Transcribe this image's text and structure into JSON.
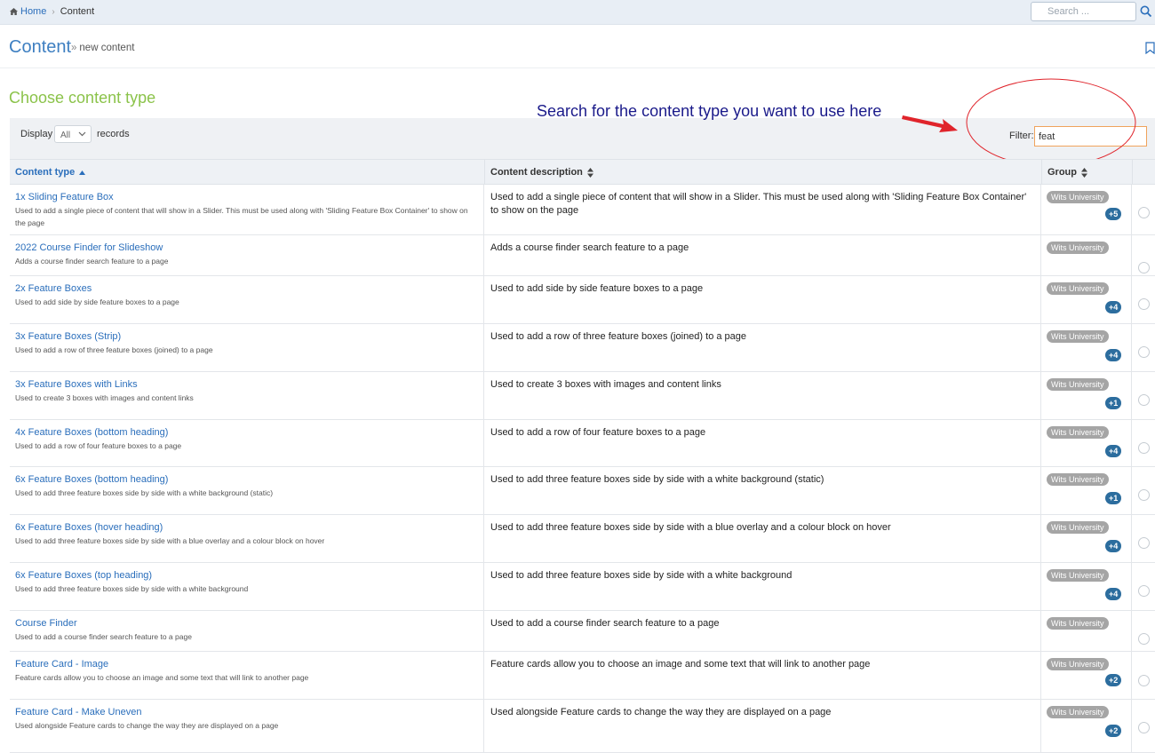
{
  "breadcrumb": {
    "home": "Home",
    "current": "Content"
  },
  "search": {
    "placeholder": "Search ..."
  },
  "page": {
    "title": "Content",
    "subtitle": "new content"
  },
  "section_title": "Choose content type",
  "controls": {
    "display_label": "Display",
    "display_value": "All",
    "records_label": "records",
    "filter_label": "Filter:",
    "filter_value": "feat"
  },
  "annotation": {
    "text": "Search for the content type you want to use here",
    "color": "#1a1a8a",
    "arrow_color": "#e0242b"
  },
  "table": {
    "headers": {
      "type": "Content type",
      "description": "Content description",
      "group": "Group"
    },
    "rows": [
      {
        "title": "1x Sliding Feature Box",
        "sub": "Used to add a single piece of content that will show in a Slider. This must be used along with 'Sliding Feature Box Container' to show on the page",
        "desc": "Used to add a single piece of content that will show in a Slider. This must be used along with 'Sliding Feature Box Container' to show on the page",
        "group": "Wits University",
        "more": "+5"
      },
      {
        "title": "2022 Course Finder for Slideshow",
        "sub": "Adds a course finder search feature to a page",
        "desc": "Adds a course finder search feature to a page",
        "group": "Wits University",
        "more": ""
      },
      {
        "title": "2x Feature Boxes",
        "sub": "Used to add side by side feature boxes to a page",
        "desc": "Used to add side by side feature boxes to a page",
        "group": "Wits University",
        "more": "+4"
      },
      {
        "title": "3x Feature Boxes (Strip)",
        "sub": "Used to add a row of three feature boxes (joined) to a page",
        "desc": "Used to add a row of three feature boxes (joined) to a page",
        "group": "Wits University",
        "more": "+4"
      },
      {
        "title": "3x Feature Boxes with Links",
        "sub": "Used to create 3 boxes with images and content links",
        "desc": "Used to create 3 boxes with images and content links",
        "group": "Wits University",
        "more": "+1"
      },
      {
        "title": "4x Feature Boxes (bottom heading)",
        "sub": "Used to add a row of four feature boxes to a page",
        "desc": "Used to add a row of four feature boxes to a page",
        "group": "Wits University",
        "more": "+4"
      },
      {
        "title": "6x Feature Boxes (bottom heading)",
        "sub": "Used to add three feature boxes side by side with a white background (static)",
        "desc": "Used to add three feature boxes side by side with a white background (static)",
        "group": "Wits University",
        "more": "+1"
      },
      {
        "title": "6x Feature Boxes (hover heading)",
        "sub": "Used to add three feature boxes side by side with a blue overlay and a colour block on hover",
        "desc": "Used to add three feature boxes side by side with a blue overlay and a colour block on hover",
        "group": "Wits University",
        "more": "+4"
      },
      {
        "title": "6x Feature Boxes (top heading)",
        "sub": "Used to add three feature boxes side by side with a white background",
        "desc": "Used to add three feature boxes side by side with a white background",
        "group": "Wits University",
        "more": "+4"
      },
      {
        "title": "Course Finder",
        "sub": "Used to add a course finder search feature to a page",
        "desc": "Used to add a course finder search feature to a page",
        "group": "Wits University",
        "more": ""
      },
      {
        "title": "Feature Card - Image",
        "sub": "Feature cards allow you to choose an image and some text that will link to another page",
        "desc": "Feature cards allow you to choose an image and some text that will link to another page",
        "group": "Wits University",
        "more": "+2"
      },
      {
        "title": "Feature Card - Make Uneven",
        "sub": "Used alongside Feature cards to change the way they are displayed on a page",
        "desc": "Used alongside Feature cards to change the way they are displayed on a page",
        "group": "Wits University",
        "more": "+2"
      }
    ]
  }
}
